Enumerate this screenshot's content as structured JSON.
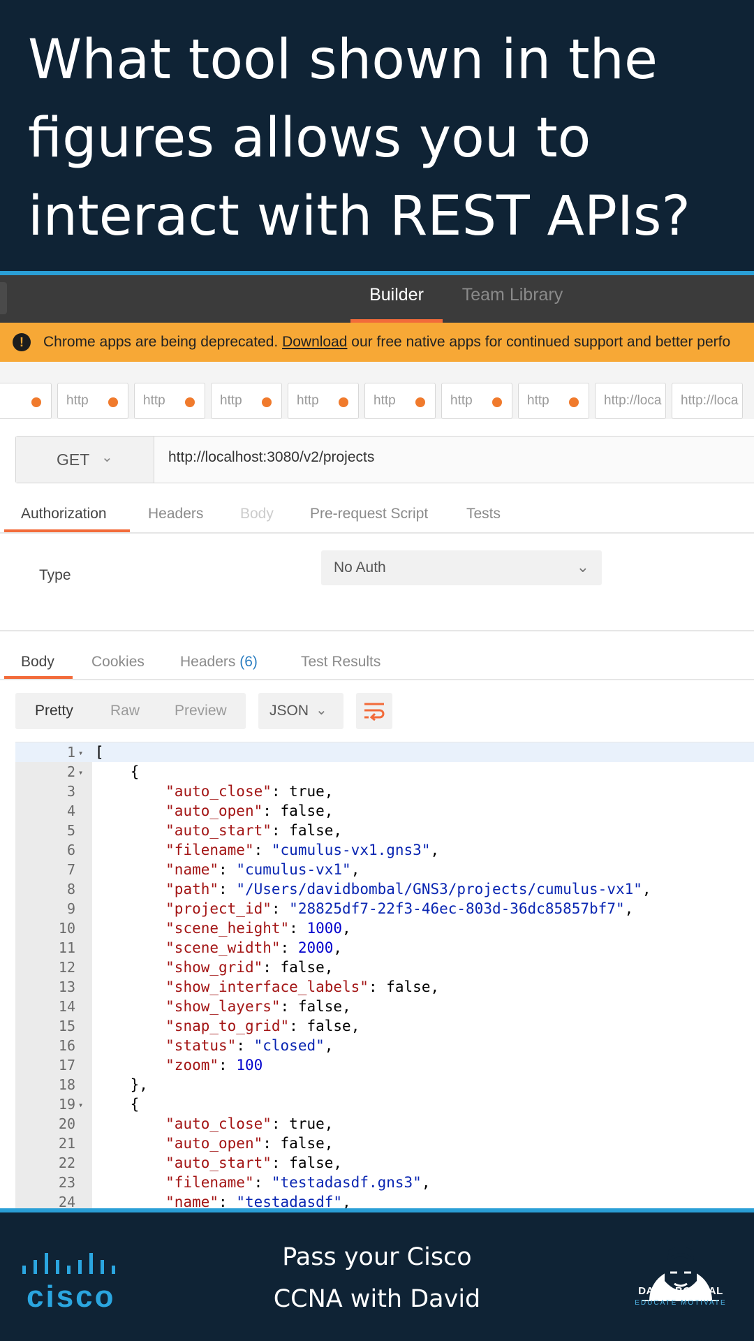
{
  "banner": {
    "question": "What tool shown in the figures allows you to interact with REST APIs?"
  },
  "app_header": {
    "tabs": [
      {
        "label": "Builder",
        "active": true
      },
      {
        "label": "Team Library",
        "active": false
      }
    ]
  },
  "warning": {
    "icon": "exclamation-icon",
    "prefix": "Chrome apps are being deprecated. ",
    "link": "Download",
    "suffix": " our free native apps for continued support and better perfo"
  },
  "request_tabs": [
    {
      "label": "http"
    },
    {
      "label": "http"
    },
    {
      "label": "http"
    },
    {
      "label": "http"
    },
    {
      "label": "http"
    },
    {
      "label": "http"
    },
    {
      "label": "http"
    },
    {
      "label": "http"
    },
    {
      "label": "http://loca"
    },
    {
      "label": "http://loca"
    }
  ],
  "request": {
    "method": "GET",
    "url": "http://localhost:3080/v2/projects"
  },
  "request_subtabs": {
    "authorization": "Authorization",
    "headers": "Headers",
    "body": "Body",
    "pre_request": "Pre-request Script",
    "tests": "Tests"
  },
  "auth": {
    "type_label": "Type",
    "selected": "No Auth"
  },
  "response_tabs": {
    "body": "Body",
    "cookies": "Cookies",
    "headers": "Headers",
    "headers_count": "(6)",
    "test_results": "Test Results"
  },
  "view": {
    "pretty": "Pretty",
    "raw": "Raw",
    "preview": "Preview",
    "format": "JSON",
    "wrap_icon": "wrap-lines-icon"
  },
  "code_lines": [
    {
      "n": "1",
      "fold": true,
      "text": "["
    },
    {
      "n": "2",
      "fold": true,
      "text": "    {"
    },
    {
      "n": "3",
      "text": "        \"auto_close\": true,"
    },
    {
      "n": "4",
      "text": "        \"auto_open\": false,"
    },
    {
      "n": "5",
      "text": "        \"auto_start\": false,"
    },
    {
      "n": "6",
      "text": "        \"filename\": \"cumulus-vx1.gns3\","
    },
    {
      "n": "7",
      "text": "        \"name\": \"cumulus-vx1\","
    },
    {
      "n": "8",
      "text": "        \"path\": \"/Users/davidbombal/GNS3/projects/cumulus-vx1\","
    },
    {
      "n": "9",
      "text": "        \"project_id\": \"28825df7-22f3-46ec-803d-36dc85857bf7\","
    },
    {
      "n": "10",
      "text": "        \"scene_height\": 1000,"
    },
    {
      "n": "11",
      "text": "        \"scene_width\": 2000,"
    },
    {
      "n": "12",
      "text": "        \"show_grid\": false,"
    },
    {
      "n": "13",
      "text": "        \"show_interface_labels\": false,"
    },
    {
      "n": "14",
      "text": "        \"show_layers\": false,"
    },
    {
      "n": "15",
      "text": "        \"snap_to_grid\": false,"
    },
    {
      "n": "16",
      "text": "        \"status\": \"closed\","
    },
    {
      "n": "17",
      "text": "        \"zoom\": 100"
    },
    {
      "n": "18",
      "text": "    },"
    },
    {
      "n": "19",
      "fold": true,
      "text": "    {"
    },
    {
      "n": "20",
      "text": "        \"auto_close\": true,"
    },
    {
      "n": "21",
      "text": "        \"auto_open\": false,"
    },
    {
      "n": "22",
      "text": "        \"auto_start\": false,"
    },
    {
      "n": "23",
      "text": "        \"filename\": \"testadasdf.gns3\","
    },
    {
      "n": "24",
      "text": "        \"name\": \"testadasdf\","
    }
  ],
  "footer": {
    "cisco_logo": "cisco",
    "line1": "Pass your Cisco",
    "line2": "CCNA with David",
    "brand_name": "DAVID BOMBAL",
    "brand_tagline": "EDUCATE MOTIVATE"
  },
  "colors": {
    "navy": "#0f2335",
    "accent_blue": "#2a9fd6",
    "postman_orange": "#f26b3a",
    "warning_orange": "#f7a836"
  }
}
